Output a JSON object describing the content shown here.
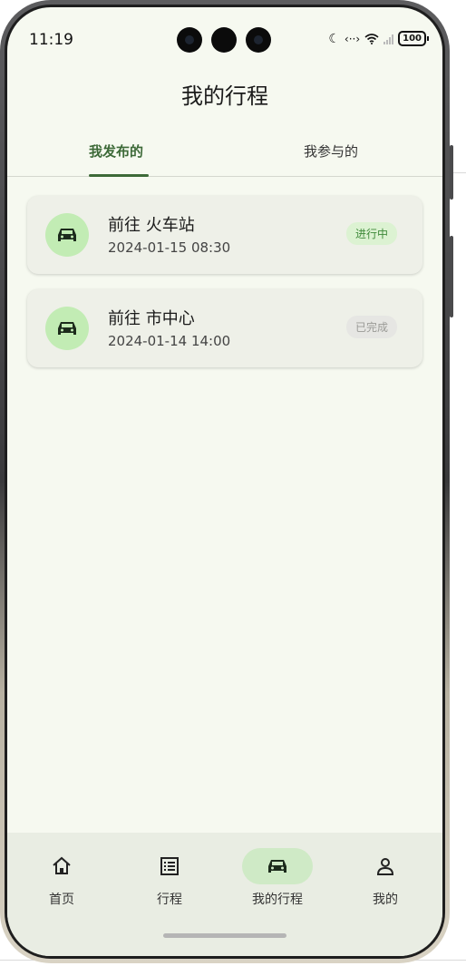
{
  "status_bar": {
    "time": "11:19",
    "battery": "100"
  },
  "page": {
    "title": "我的行程"
  },
  "tabs": [
    {
      "label": "我发布的",
      "selected": true
    },
    {
      "label": "我参与的",
      "selected": false
    }
  ],
  "trips": [
    {
      "destination": "前往 火车站",
      "datetime": "2024-01-15 08:30",
      "status": "进行中",
      "icon": "car-icon"
    },
    {
      "destination": "前往 市中心",
      "datetime": "2024-01-14 14:00",
      "status": "已完成",
      "icon": "car-icon"
    }
  ],
  "bottom_nav": [
    {
      "label": "首页",
      "icon": "home-icon",
      "selected": false
    },
    {
      "label": "行程",
      "icon": "list-icon",
      "selected": false
    },
    {
      "label": "我的行程",
      "icon": "car-icon",
      "selected": true
    },
    {
      "label": "我的",
      "icon": "person-icon",
      "selected": false
    }
  ],
  "colors": {
    "background": "#f6f9f0",
    "accent": "#3d6a38",
    "status_active_bg": "#dcf2d2",
    "status_done_bg": "#e6e6e3",
    "avatar_bg": "#c2ecb4"
  }
}
